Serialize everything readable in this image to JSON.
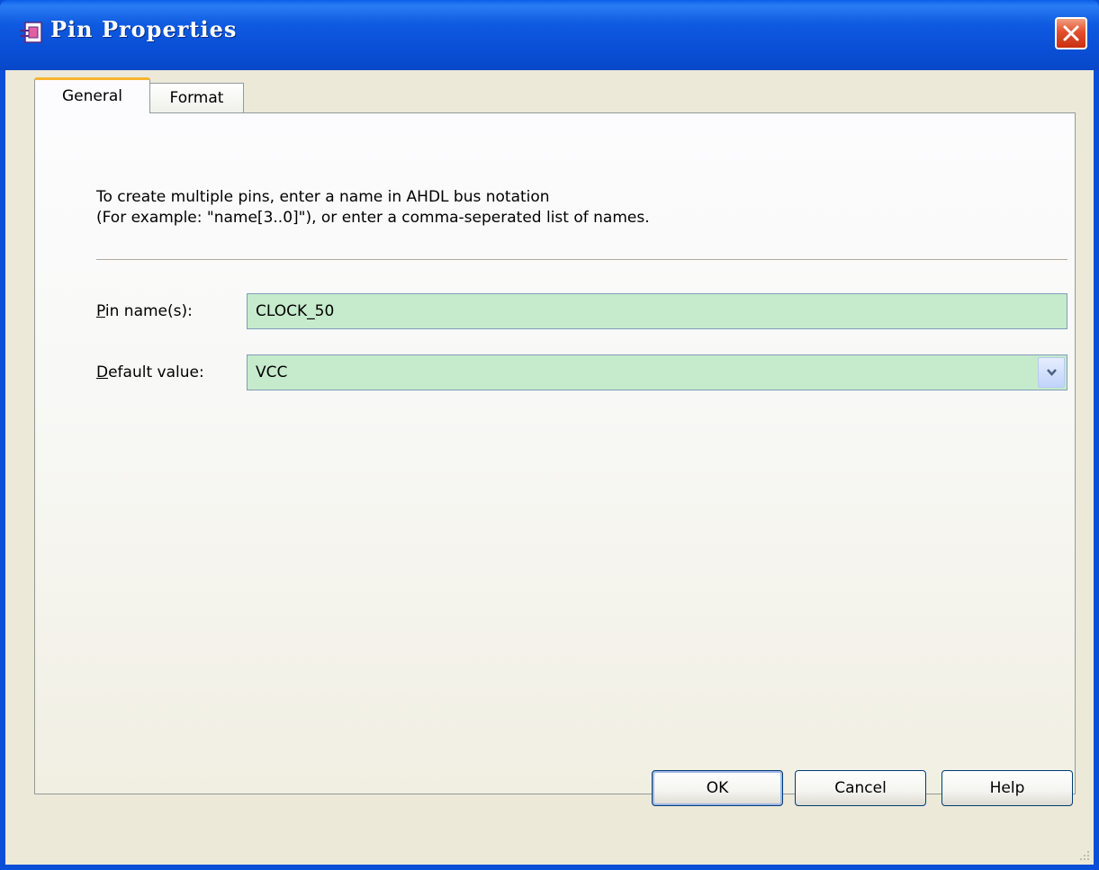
{
  "window": {
    "title": "Pin Properties",
    "icon": "pin-app-icon",
    "close_icon": "close-icon"
  },
  "tabs": [
    {
      "label": "General",
      "selected": true
    },
    {
      "label": "Format",
      "selected": false
    }
  ],
  "general": {
    "instruction_line1": "To create multiple pins, enter a name in AHDL bus notation",
    "instruction_line2": "(For example: \"name[3..0]\"), or enter a comma-seperated list of names.",
    "pin_name": {
      "label_mnemonic": "P",
      "label_rest": "in name(s):",
      "value": "CLOCK_50"
    },
    "default_value": {
      "label_mnemonic": "D",
      "label_rest": "efault value:",
      "value": "VCC",
      "dropdown_icon": "chevron-down-icon"
    }
  },
  "buttons": {
    "ok": "OK",
    "cancel": "Cancel",
    "help": "Help"
  },
  "colors": {
    "titlebar": "#0a4fd6",
    "field_bg": "#c6ebcc",
    "dialog_bg": "#ece9d8",
    "tab_accent": "#f7b430"
  }
}
